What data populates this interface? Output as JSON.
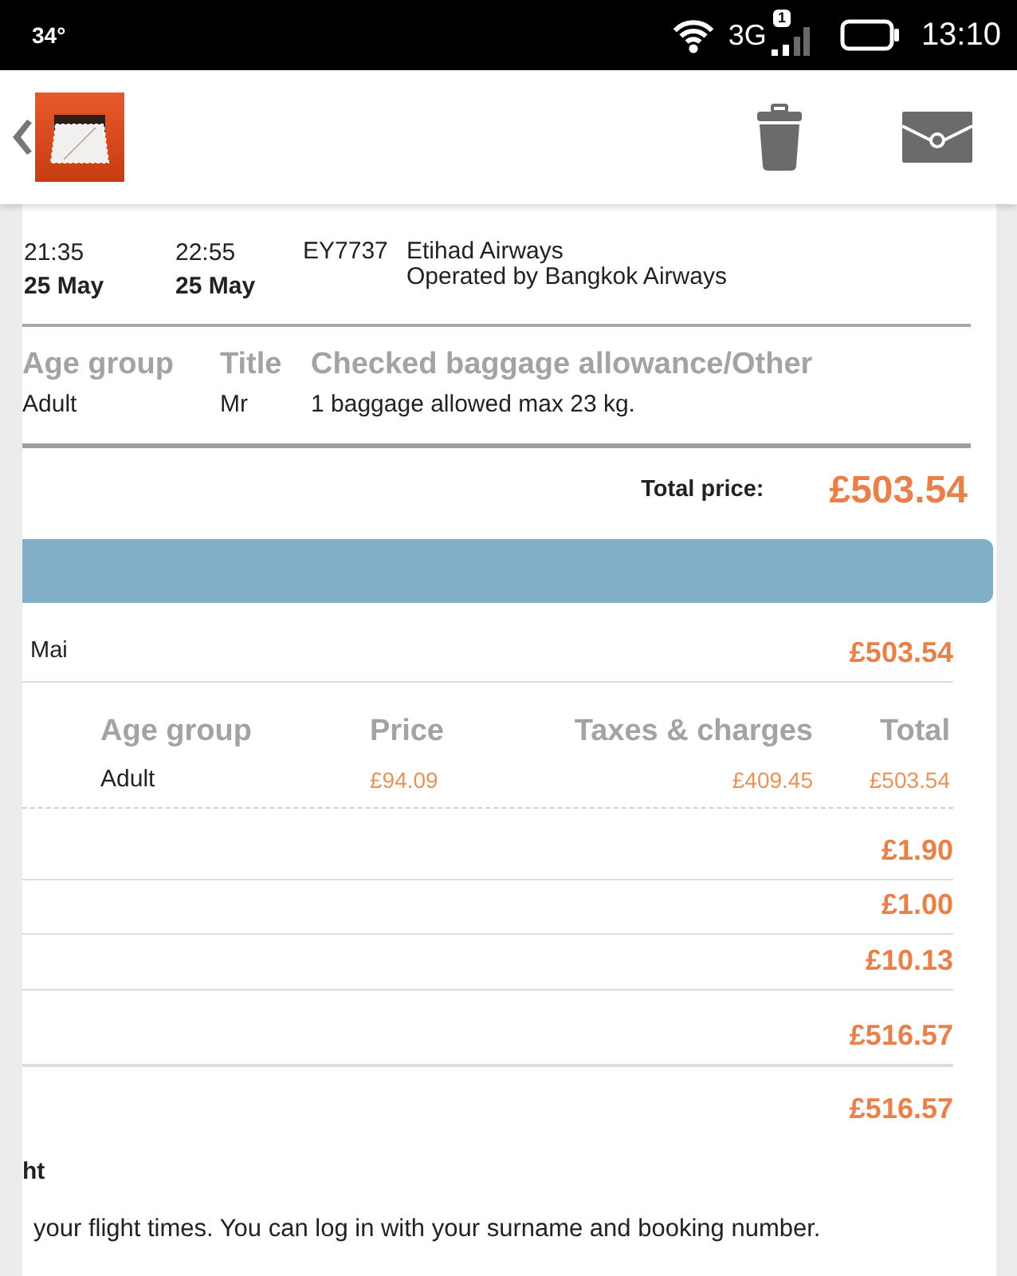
{
  "status_bar": {
    "temperature": "34°",
    "network": "3G",
    "sim_slot": "1",
    "time": "13:10"
  },
  "flight": {
    "departure_time": "21:35",
    "departure_date": "25 May",
    "arrival_time": "22:55",
    "arrival_date": "25 May",
    "flight_number": "EY7737",
    "airline": "Etihad Airways",
    "operator": "Operated by Bangkok Airways"
  },
  "passenger_table": {
    "columns": [
      "Age group",
      "Title",
      "Checked baggage allowance/Other"
    ],
    "rows": [
      [
        "Adult",
        "Mr",
        "1 baggage allowed max 23 kg."
      ]
    ]
  },
  "total_price": {
    "label": "Total price:",
    "amount": "£503.54"
  },
  "passenger": {
    "name": "Mai",
    "amount": "£503.54"
  },
  "fare_table": {
    "columns": [
      "Age group",
      "Price",
      "Taxes & charges",
      "Total"
    ],
    "rows": [
      [
        "Adult",
        "£94.09",
        "£409.45",
        "£503.54"
      ]
    ]
  },
  "charges": [
    "£1.90",
    "£1.00",
    "£10.13"
  ],
  "subtotal": "£516.57",
  "grand_total": "£516.57",
  "info": {
    "heading": "ht",
    "text": "your flight times. You can log in with your surname and booking number."
  }
}
